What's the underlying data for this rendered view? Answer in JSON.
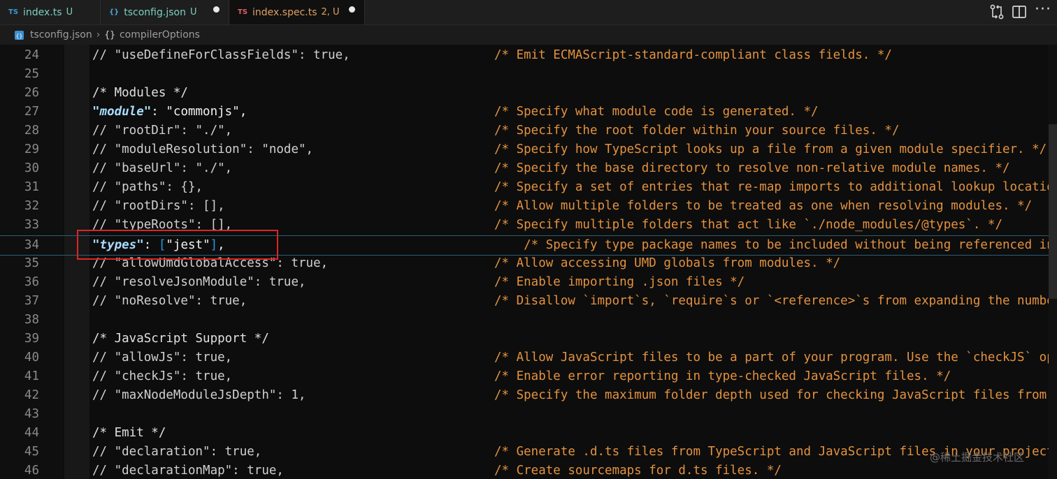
{
  "tabs": [
    {
      "icon": "TS",
      "name": "index.ts",
      "status": "U",
      "name_color": "#7ad0c0",
      "icon_color": "#3a9ad9",
      "modified": false
    },
    {
      "icon": "{}",
      "name": "tsconfig.json",
      "status": "U",
      "name_color": "#7ad0c0",
      "icon_color": "#4aa3d6",
      "modified": true
    },
    {
      "icon": "TS",
      "name": "index.spec.ts",
      "status": "2, U",
      "name_color": "#e0a060",
      "icon_color": "#e06060",
      "modified": true
    }
  ],
  "toolbar": {
    "compare_icon": "git-compare-icon",
    "split_icon": "split-editor-icon"
  },
  "breadcrumb": {
    "file": "tsconfig.json",
    "separator": "›",
    "object_glyph": "{}",
    "section": "compilerOptions"
  },
  "editor": {
    "active_line": 34,
    "lines": [
      {
        "n": "24",
        "tokens": [
          [
            "c",
            "// \"useDefineForClassFields\": true,"
          ]
        ],
        "comment": "/* Emit ECMAScript-standard-compliant class fields. */"
      },
      {
        "n": "25",
        "tokens": [],
        "comment": ""
      },
      {
        "n": "26",
        "tokens": [
          [
            "h",
            "/* Modules */"
          ]
        ],
        "comment": ""
      },
      {
        "n": "27",
        "tokens": [
          [
            "k",
            "\"module\""
          ],
          [
            "s",
            ": \"commonjs\","
          ]
        ],
        "comment": "/* Specify what module code is generated. */"
      },
      {
        "n": "28",
        "tokens": [
          [
            "c",
            "// \"rootDir\": \"./\","
          ]
        ],
        "comment": "/* Specify the root folder within your source files. */"
      },
      {
        "n": "29",
        "tokens": [
          [
            "c",
            "// \"moduleResolution\": \"node\","
          ]
        ],
        "comment": "/* Specify how TypeScript looks up a file from a given module specifier. */"
      },
      {
        "n": "30",
        "tokens": [
          [
            "c",
            "// \"baseUrl\": \"./\","
          ]
        ],
        "comment": "/* Specify the base directory to resolve non-relative module names. */"
      },
      {
        "n": "31",
        "tokens": [
          [
            "c",
            "// \"paths\": {},"
          ]
        ],
        "comment": "/* Specify a set of entries that re-map imports to additional lookup locations. */"
      },
      {
        "n": "32",
        "tokens": [
          [
            "c",
            "// \"rootDirs\": [],"
          ]
        ],
        "comment": "/* Allow multiple folders to be treated as one when resolving modules. */"
      },
      {
        "n": "33",
        "tokens": [
          [
            "c",
            "// \"typeRoots\": [],"
          ]
        ],
        "comment": "/* Specify multiple folders that act like `./node_modules/@types`. */"
      },
      {
        "n": "34",
        "tokens": [
          [
            "k",
            "\"types\""
          ],
          [
            "s",
            ": "
          ],
          [
            "b",
            "["
          ],
          [
            "s",
            "\"jest\""
          ],
          [
            "b",
            "]"
          ],
          [
            "s",
            ","
          ]
        ],
        "comment": "    /* Specify type package names to be included without being referenced in a source file. */"
      },
      {
        "n": "35",
        "tokens": [
          [
            "c",
            "// \"allowUmdGlobalAccess\": true,"
          ]
        ],
        "comment": "/* Allow accessing UMD globals from modules. */"
      },
      {
        "n": "36",
        "tokens": [
          [
            "c",
            "// \"resolveJsonModule\": true,"
          ]
        ],
        "comment": "/* Enable importing .json files */"
      },
      {
        "n": "37",
        "tokens": [
          [
            "c",
            "// \"noResolve\": true,"
          ]
        ],
        "comment": "/* Disallow `import`s, `require`s or `<reference>`s from expanding the number of files. */"
      },
      {
        "n": "38",
        "tokens": [],
        "comment": ""
      },
      {
        "n": "39",
        "tokens": [
          [
            "h",
            "/* JavaScript Support */"
          ]
        ],
        "comment": ""
      },
      {
        "n": "40",
        "tokens": [
          [
            "c",
            "// \"allowJs\": true,"
          ]
        ],
        "comment": "/* Allow JavaScript files to be a part of your program. Use the `checkJS` option to get errors. */"
      },
      {
        "n": "41",
        "tokens": [
          [
            "c",
            "// \"checkJs\": true,"
          ]
        ],
        "comment": "/* Enable error reporting in type-checked JavaScript files. */"
      },
      {
        "n": "42",
        "tokens": [
          [
            "c",
            "// \"maxNodeModuleJsDepth\": 1,"
          ]
        ],
        "comment": "/* Specify the maximum folder depth used for checking JavaScript files from node_modules. */"
      },
      {
        "n": "43",
        "tokens": [],
        "comment": ""
      },
      {
        "n": "44",
        "tokens": [
          [
            "h",
            "/* Emit */"
          ]
        ],
        "comment": ""
      },
      {
        "n": "45",
        "tokens": [
          [
            "c",
            "// \"declaration\": true,"
          ]
        ],
        "comment": "/* Generate .d.ts files from TypeScript and JavaScript files in your project. */"
      },
      {
        "n": "46",
        "tokens": [
          [
            "c",
            "// \"declarationMap\": true,"
          ]
        ],
        "comment": "/* Create sourcemaps for d.ts files. */"
      }
    ]
  },
  "annotation": {
    "color": "#dc2626",
    "target_line": 34
  },
  "watermark": "@稀土掘金技术社区",
  "colors": {
    "background": "#0d0d0d",
    "comment": "#e4923f",
    "line_number": "#8a8a8a",
    "key": "#a8dcff",
    "bracket": "#1f9bdc"
  }
}
